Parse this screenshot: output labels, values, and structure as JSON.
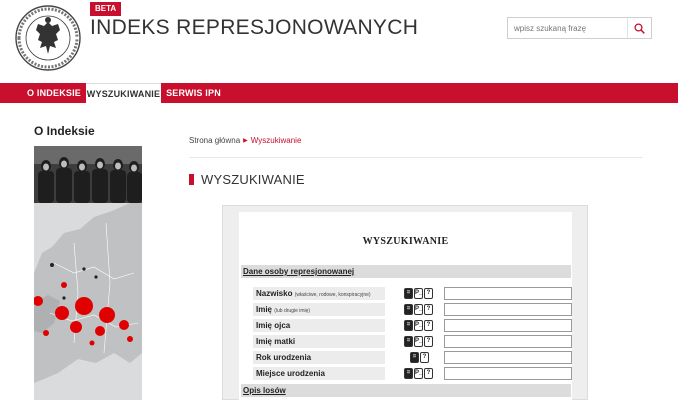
{
  "header": {
    "beta_badge": "BETA",
    "site_title": "INDEKS REPRESJONOWANYCH",
    "logo_text": "INSTYTUT PAMIĘCI NARODOWEJ",
    "search_placeholder": "wpisz szukaną frazę",
    "search_icon": "magnifier-icon"
  },
  "nav": {
    "items": [
      {
        "label": "O INDEKSIE"
      },
      {
        "label": "WYSZUKIWANIE"
      },
      {
        "label": "SERWIS IPN"
      }
    ]
  },
  "sidebar": {
    "title": "O Indeksie"
  },
  "main": {
    "breadcrumb": {
      "home": "Strona główna",
      "current": "Wyszukiwanie"
    },
    "page_title": "WYSZUKIWANIE",
    "form": {
      "heading": "WYSZUKIWANIE",
      "section1": "Dane osoby represjonowanej",
      "section2": "Opis losów",
      "fields": [
        {
          "label": "Nazwisko",
          "hint": "(właściwe, rodowe, konspiracyjne)"
        },
        {
          "label": "Imię",
          "hint": "(lub drugie imię)"
        },
        {
          "label": "Imię ojca",
          "hint": ""
        },
        {
          "label": "Imię matki",
          "hint": ""
        },
        {
          "label": "Rok urodzenia",
          "hint": ""
        },
        {
          "label": "Miejsce urodzenia",
          "hint": ""
        }
      ],
      "mode_buttons": {
        "exact": "=",
        "prefix": "P_",
        "fuzzy": "?"
      }
    }
  },
  "colors": {
    "accent": "#c8102e",
    "panel_bg": "#eeeeee",
    "section_bg": "#dcdcdc"
  }
}
